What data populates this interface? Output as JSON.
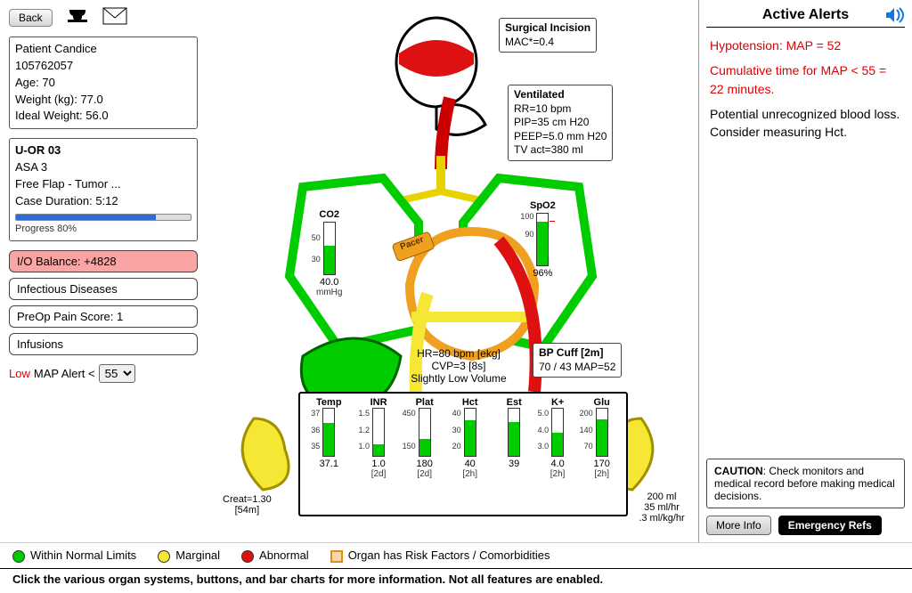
{
  "toolbar": {
    "back": "Back"
  },
  "patient": {
    "name_line": "Patient Candice",
    "id": "105762057",
    "age_line": "Age: 70",
    "weight_line": "Weight (kg): 77.0",
    "ideal_weight_line": "Ideal Weight: 56.0"
  },
  "case": {
    "room": "U-OR 03",
    "asa": "ASA 3",
    "procedure": "Free Flap - Tumor ...",
    "duration_line": "Case Duration: 5:12",
    "progress_pct": 80,
    "progress_text": "Progress 80%"
  },
  "buttons": {
    "io": "I/O Balance: +4828",
    "infectious": "Infectious Diseases",
    "preop": "PreOp Pain Score: 1",
    "infusions": "Infusions"
  },
  "map_alert": {
    "low_label": "Low",
    "label": " MAP Alert < ",
    "value": "55"
  },
  "mid": {
    "incision": {
      "title": "Surgical Incision",
      "line1": "MAC*=0.4"
    },
    "vent": {
      "title": "Ventilated",
      "rr": "RR=10 bpm",
      "pip": "PIP=35 cm H20",
      "peep": "PEEP=5.0 mm H20",
      "tv": "TV act=380 ml"
    },
    "co2": {
      "label": "CO2",
      "ticks": [
        "50",
        "30"
      ],
      "value": "40.0",
      "unit": "mmHg",
      "fill_pct": 55
    },
    "spo2": {
      "label": "SpO2",
      "ticks": [
        "100",
        "90"
      ],
      "value": "96%",
      "fill_pct": 85
    },
    "pacer": "Pacer",
    "heart": {
      "hr": "HR=80 bpm [ekg]",
      "cvp": "CVP=3 [8s]",
      "vol": "Slightly Low Volume"
    },
    "bp": {
      "title": "BP Cuff [2m]",
      "value": "70 / 43 MAP=52"
    },
    "creat": "Creat=1.30\n[54m]",
    "urine": {
      "vol": "200 ml",
      "rate1": "35 ml/hr",
      "rate2": ".3 ml/kg/hr"
    },
    "labs": [
      {
        "label": "Temp",
        "ticks": [
          "37",
          "36",
          "35"
        ],
        "value": "37.1",
        "sub": "",
        "fill": 70
      },
      {
        "label": "INR",
        "ticks": [
          "1.5",
          "1.2",
          "1.0"
        ],
        "value": "1.0",
        "sub": "[2d]",
        "fill": 25
      },
      {
        "label": "Plat",
        "ticks": [
          "450",
          "150"
        ],
        "value": "180",
        "sub": "[2d]",
        "fill": 35
      },
      {
        "label": "Hct",
        "ticks": [
          "40",
          "30",
          "20"
        ],
        "value": "40",
        "sub": "[2h]",
        "fill": 75
      },
      {
        "label": "Est",
        "ticks": [],
        "value": "39",
        "sub": "",
        "fill": 72
      },
      {
        "label": "K+",
        "ticks": [
          "5.0",
          "4.0",
          "3.0"
        ],
        "value": "4.0",
        "sub": "[2h]",
        "fill": 50
      },
      {
        "label": "Glu",
        "ticks": [
          "200",
          "140",
          "70"
        ],
        "value": "170",
        "sub": "[2h]",
        "fill": 78
      }
    ]
  },
  "legend": {
    "normal": "Within Normal Limits",
    "marginal": "Marginal",
    "abnormal": "Abnormal",
    "risk": "Organ has Risk Factors / Comorbidities"
  },
  "footer": "Click the various organ systems, buttons, and bar charts for more information. Not all features are enabled.",
  "alerts": {
    "title": "Active Alerts",
    "line1": "Hypotension: MAP = 52",
    "line2": "Cumulative time for MAP < 55 = 22 minutes.",
    "line3": "Potential unrecognized blood loss. Consider measuring Hct.",
    "caution_label": "CAUTION",
    "caution_text": ": Check monitors and medical record before making medical decisions.",
    "more": "More Info",
    "emergency": "Emergency Refs"
  }
}
